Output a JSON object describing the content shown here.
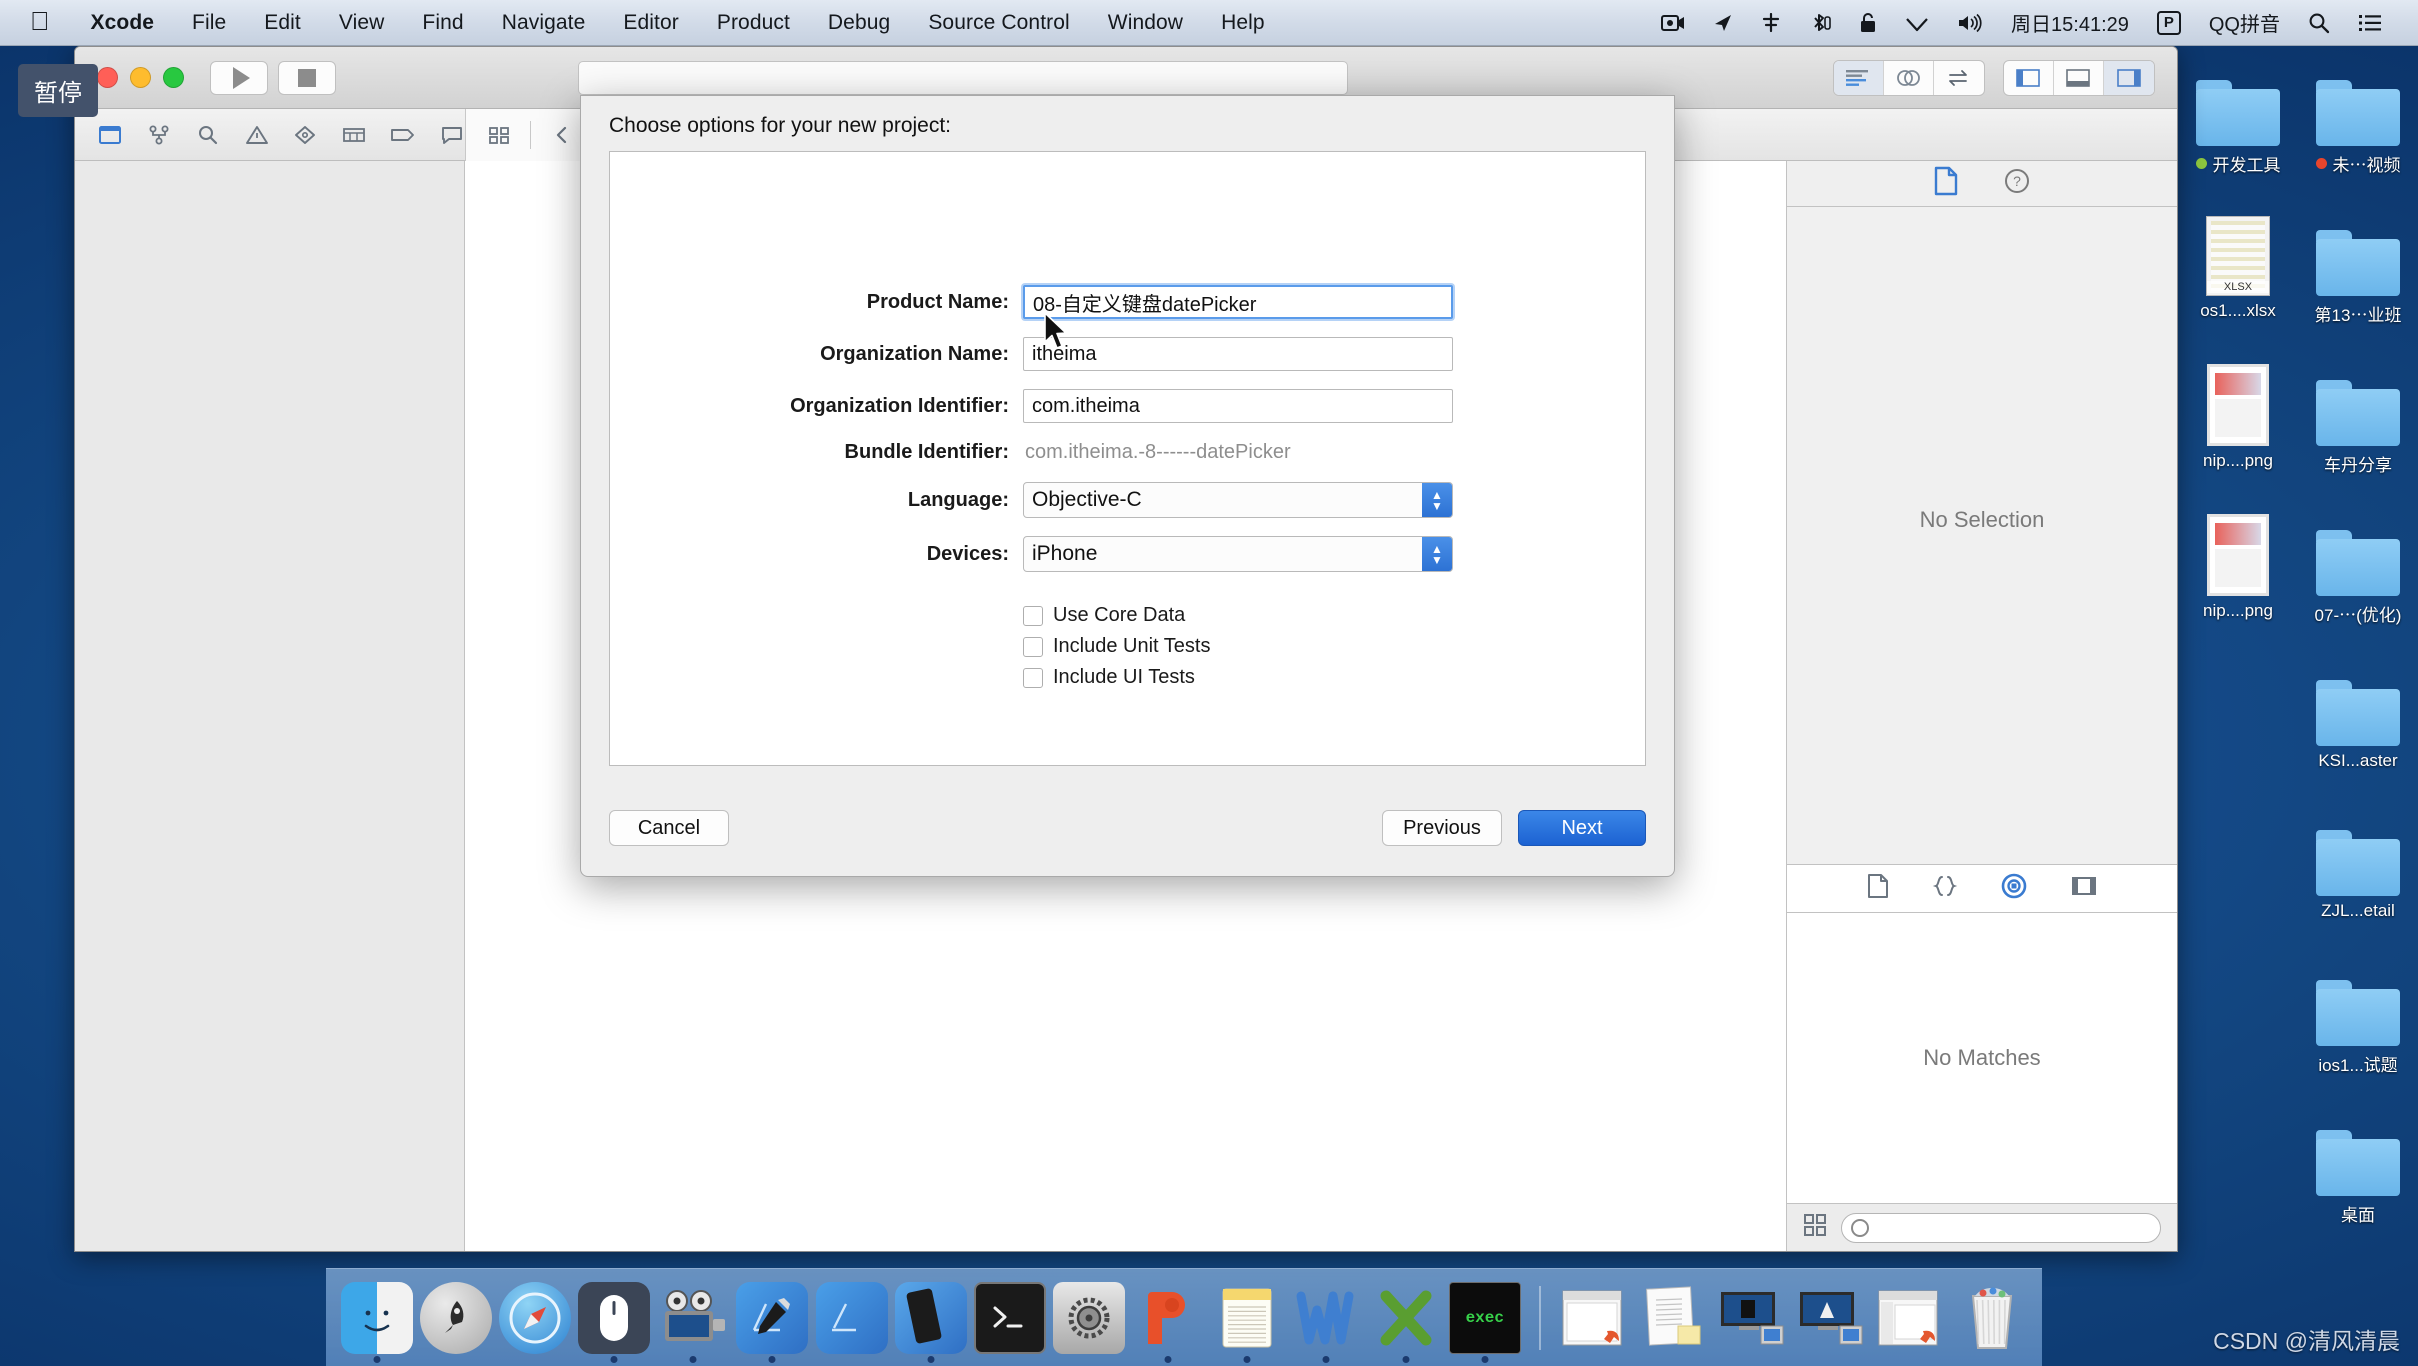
{
  "menubar": {
    "apple_icon": "apple-logo-icon",
    "items": [
      {
        "label": "Xcode",
        "bold": true
      },
      {
        "label": "File",
        "bold": false
      },
      {
        "label": "Edit",
        "bold": false
      },
      {
        "label": "View",
        "bold": false
      },
      {
        "label": "Find",
        "bold": false
      },
      {
        "label": "Navigate",
        "bold": false
      },
      {
        "label": "Editor",
        "bold": false
      },
      {
        "label": "Product",
        "bold": false
      },
      {
        "label": "Debug",
        "bold": false
      },
      {
        "label": "Source Control",
        "bold": false
      },
      {
        "label": "Window",
        "bold": false
      },
      {
        "label": "Help",
        "bold": false
      }
    ],
    "status": {
      "screen_record_icon": "screen-record-icon",
      "location_icon": "location-arrow-icon",
      "airdrop_icon": "airdrop-icon",
      "bluetooth_icon": "bluetooth-icon",
      "lock_icon": "lock-icon",
      "wifi_icon": "wifi-icon",
      "volume_icon": "volume-icon",
      "clock": "周日15:41:29",
      "p_badge": "P",
      "input_method": "QQ拼音",
      "search_icon": "spotlight-search-icon",
      "notification_icon": "notification-center-icon"
    }
  },
  "tooltip": {
    "text": "暂停"
  },
  "xcode": {
    "toolbar": {
      "run_icon": "play-run-icon",
      "stop_icon": "stop-square-icon",
      "scheme_field_value": "",
      "editor_modes": [
        "standard-editor-icon",
        "assistant-editor-icon",
        "version-editor-icon"
      ],
      "view_toggles": [
        "navigator-toggle-icon",
        "debug-area-toggle-icon",
        "utilities-toggle-icon"
      ]
    },
    "navigator_tabs": [
      "project-navigator-icon",
      "source-control-navigator-icon",
      "find-navigator-icon",
      "issue-navigator-icon",
      "test-navigator-icon",
      "debug-navigator-icon",
      "breakpoint-navigator-icon",
      "report-navigator-icon"
    ],
    "jump_bar": {
      "related_items_icon": "related-items-icon",
      "back_icon": "chevron-left-icon",
      "forward_icon": "chevron-right-icon"
    },
    "utilities": {
      "tabs": [
        "file-inspector-icon",
        "quick-help-inspector-icon"
      ],
      "empty_text": "No Selection",
      "library_tabs": [
        "file-template-library-icon",
        "code-snippet-library-icon",
        "media-library-icon",
        "object-library-icon"
      ],
      "library_empty_text": "No Matches",
      "library_search_placeholder": ""
    }
  },
  "sheet": {
    "title": "Choose options for your new project:",
    "fields": [
      {
        "label": "Product Name:",
        "value": "08-自定义键盘datePicker",
        "type": "text",
        "focused": true
      },
      {
        "label": "Organization Name:",
        "value": "itheima",
        "type": "text",
        "focused": false
      },
      {
        "label": "Organization Identifier:",
        "value": "com.itheima",
        "type": "text",
        "focused": false
      },
      {
        "label": "Bundle Identifier:",
        "value": "com.itheima.-8------datePicker",
        "type": "static",
        "focused": false
      },
      {
        "label": "Language:",
        "value": "Objective-C",
        "type": "select",
        "focused": false
      },
      {
        "label": "Devices:",
        "value": "iPhone",
        "type": "select",
        "focused": false
      }
    ],
    "checkboxes": [
      {
        "label": "Use Core Data",
        "checked": false
      },
      {
        "label": "Include Unit Tests",
        "checked": false
      },
      {
        "label": "Include UI Tests",
        "checked": false
      }
    ],
    "buttons": {
      "cancel": "Cancel",
      "previous": "Previous",
      "next": "Next"
    },
    "accent_color": "#2d72d4"
  },
  "desktop": {
    "icons": [
      {
        "label": "开发工具",
        "type": "folder",
        "dot": "#8dc63f"
      },
      {
        "label": "未⋯视频",
        "type": "folder",
        "dot": "#e8452c"
      },
      {
        "label": "os1....xlsx",
        "type": "xlsx",
        "dot": ""
      },
      {
        "label": "第13⋯业班",
        "type": "folder",
        "dot": ""
      },
      {
        "label": "nip....png",
        "type": "png",
        "dot": ""
      },
      {
        "label": "车丹分享",
        "type": "folder",
        "dot": ""
      },
      {
        "label": "nip....png",
        "type": "png",
        "dot": ""
      },
      {
        "label": "07-⋯(优化)",
        "type": "folder",
        "dot": ""
      },
      {
        "label": "",
        "type": "blank",
        "dot": ""
      },
      {
        "label": "KSI...aster",
        "type": "folder",
        "dot": ""
      },
      {
        "label": "",
        "type": "blank",
        "dot": ""
      },
      {
        "label": "ZJL...etail",
        "type": "folder",
        "dot": ""
      },
      {
        "label": "",
        "type": "blank",
        "dot": ""
      },
      {
        "label": "ios1...试题",
        "type": "folder",
        "dot": ""
      },
      {
        "label": "",
        "type": "blank",
        "dot": ""
      },
      {
        "label": "桌面",
        "type": "folder",
        "dot": ""
      }
    ]
  },
  "dock": {
    "items": [
      {
        "name": "finder-icon",
        "running": true
      },
      {
        "name": "launchpad-icon",
        "running": false
      },
      {
        "name": "safari-icon",
        "running": false
      },
      {
        "name": "mouse-recorder-icon",
        "running": true
      },
      {
        "name": "quicktime-player-icon",
        "running": true
      },
      {
        "name": "xcode-icon",
        "running": true
      },
      {
        "name": "xcode-beta-icon",
        "running": false
      },
      {
        "name": "simulator-icon",
        "running": true
      },
      {
        "name": "terminal-icon",
        "running": false
      },
      {
        "name": "system-preferences-icon",
        "running": false
      },
      {
        "name": "powerpoint-icon",
        "running": true
      },
      {
        "name": "notes-icon",
        "running": true
      },
      {
        "name": "word-icon",
        "running": true
      },
      {
        "name": "excel-icon",
        "running": true
      },
      {
        "name": "exec-terminal-icon",
        "running": true
      }
    ],
    "minimized": [
      {
        "name": "minimized-window-1"
      },
      {
        "name": "minimized-note-window"
      },
      {
        "name": "minimized-window-3"
      },
      {
        "name": "minimized-window-4"
      },
      {
        "name": "minimized-window-5"
      }
    ],
    "trash_icon": "trash-icon"
  },
  "watermark": {
    "text": "CSDN @清风清晨"
  }
}
